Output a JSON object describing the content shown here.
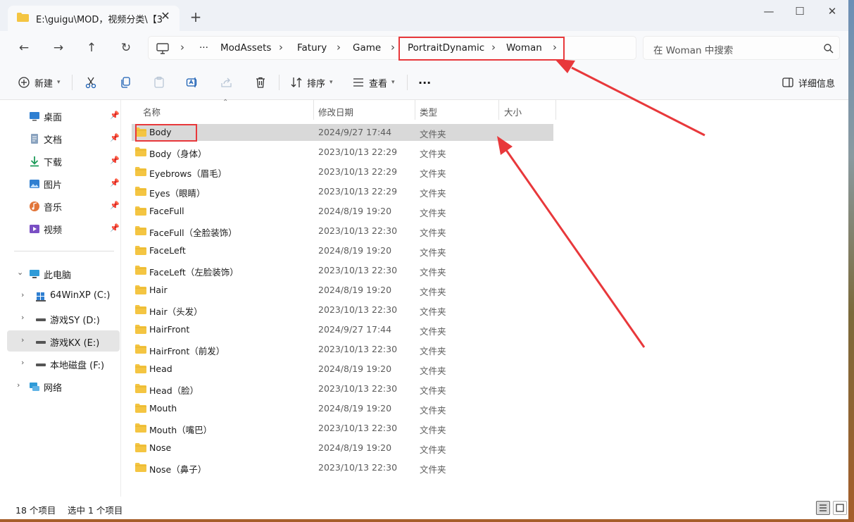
{
  "window": {
    "tab_title": "E:\\guigu\\MOD，视频分类\\【3",
    "new_tab": "+",
    "minimize": "—",
    "maximize": "☐",
    "close": "✕"
  },
  "nav": {
    "back": "←",
    "forward": "→",
    "up": "↑",
    "refresh": "↻"
  },
  "breadcrumb": {
    "overflow": "···",
    "items": [
      "ModAssets",
      "Fatury",
      "Game",
      "PortraitDynamic",
      "Woman"
    ]
  },
  "search": {
    "placeholder": "在 Woman 中搜索"
  },
  "toolbar": {
    "new_label": "新建",
    "sort_label": "排序",
    "view_label": "查看",
    "more": "···",
    "details_label": "详细信息"
  },
  "sidebar": {
    "quick_access": [
      {
        "label": "桌面",
        "icon": "desktop-icon"
      },
      {
        "label": "文档",
        "icon": "documents-icon"
      },
      {
        "label": "下载",
        "icon": "downloads-icon"
      },
      {
        "label": "图片",
        "icon": "pictures-icon"
      },
      {
        "label": "音乐",
        "icon": "music-icon"
      },
      {
        "label": "视频",
        "icon": "videos-icon"
      }
    ],
    "this_pc": "此电脑",
    "drives": [
      {
        "label": "64WinXP  (C:)"
      },
      {
        "label": "游戏SY (D:)"
      },
      {
        "label": "游戏KX (E:)"
      },
      {
        "label": "本地磁盘 (F:)"
      }
    ],
    "network": "网络"
  },
  "columns": {
    "name": "名称",
    "date": "修改日期",
    "type": "类型",
    "size": "大小"
  },
  "files": [
    {
      "name": "Body",
      "date": "2024/9/27 17:44",
      "type": "文件夹"
    },
    {
      "name": "Body（身体）",
      "date": "2023/10/13 22:29",
      "type": "文件夹"
    },
    {
      "name": "Eyebrows（眉毛）",
      "date": "2023/10/13 22:29",
      "type": "文件夹"
    },
    {
      "name": "Eyes（眼睛）",
      "date": "2023/10/13 22:29",
      "type": "文件夹"
    },
    {
      "name": "FaceFull",
      "date": "2024/8/19 19:20",
      "type": "文件夹"
    },
    {
      "name": "FaceFull（全脸装饰）",
      "date": "2023/10/13 22:30",
      "type": "文件夹"
    },
    {
      "name": "FaceLeft",
      "date": "2024/8/19 19:20",
      "type": "文件夹"
    },
    {
      "name": "FaceLeft（左脸装饰）",
      "date": "2023/10/13 22:30",
      "type": "文件夹"
    },
    {
      "name": "Hair",
      "date": "2024/8/19 19:20",
      "type": "文件夹"
    },
    {
      "name": "Hair（头发）",
      "date": "2023/10/13 22:30",
      "type": "文件夹"
    },
    {
      "name": "HairFront",
      "date": "2024/9/27 17:44",
      "type": "文件夹"
    },
    {
      "name": "HairFront（前发）",
      "date": "2023/10/13 22:30",
      "type": "文件夹"
    },
    {
      "name": "Head",
      "date": "2024/8/19 19:20",
      "type": "文件夹"
    },
    {
      "name": "Head（脸）",
      "date": "2023/10/13 22:30",
      "type": "文件夹"
    },
    {
      "name": "Mouth",
      "date": "2024/8/19 19:20",
      "type": "文件夹"
    },
    {
      "name": "Mouth（嘴巴）",
      "date": "2023/10/13 22:30",
      "type": "文件夹"
    },
    {
      "name": "Nose",
      "date": "2024/8/19 19:20",
      "type": "文件夹"
    },
    {
      "name": "Nose（鼻子）",
      "date": "2023/10/13 22:30",
      "type": "文件夹"
    }
  ],
  "status": {
    "count": "18 个项目",
    "selected": "选中 1 个项目"
  },
  "colors": {
    "annotation": "#e8383b",
    "folder": "#f4c542",
    "selected_row": "#d9d9d9"
  }
}
